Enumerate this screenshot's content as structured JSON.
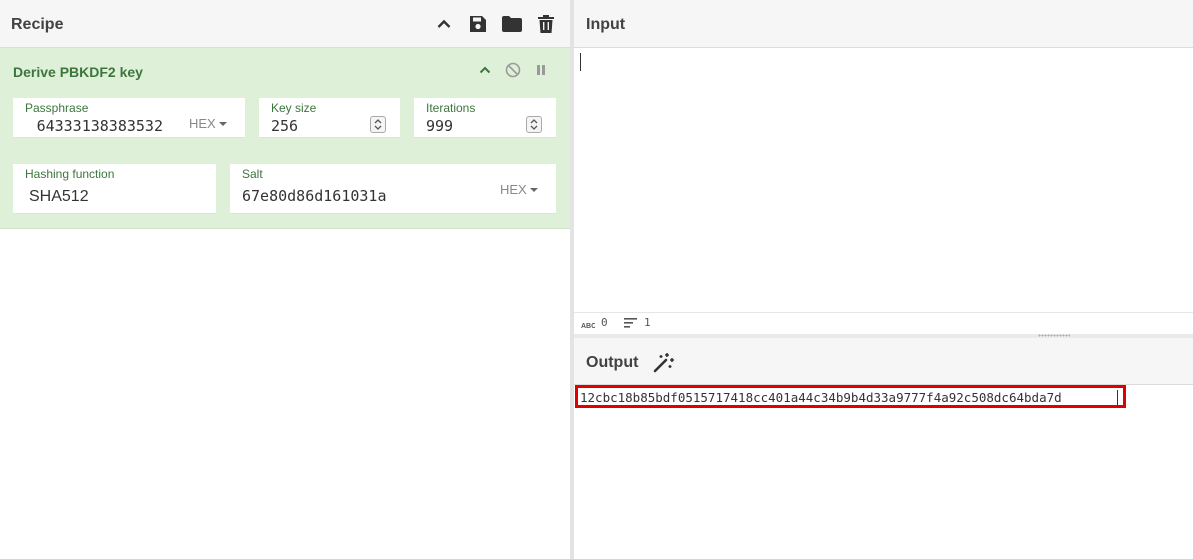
{
  "recipe": {
    "title": "Recipe",
    "header_icons": [
      "chevron-up-icon",
      "save-icon",
      "folder-icon",
      "trash-icon"
    ],
    "operation": {
      "title": "Derive PBKDF2 key",
      "icons": [
        "chevron-up-icon",
        "disable-icon",
        "pause-icon"
      ],
      "passphrase": {
        "label": "Passphrase",
        "value": "64333138383532",
        "format": "HEX"
      },
      "key_size": {
        "label": "Key size",
        "value": "256"
      },
      "iterations": {
        "label": "Iterations",
        "value": "999"
      },
      "hashing_function": {
        "label": "Hashing function",
        "value": "SHA512"
      },
      "salt": {
        "label": "Salt",
        "value": "67e80d86d161031a",
        "format": "HEX"
      }
    }
  },
  "input": {
    "title": "Input",
    "value": "",
    "status": {
      "length": "0",
      "lines": "1"
    }
  },
  "output": {
    "title": "Output",
    "value": "12cbc18b85bdf0515717418cc401a44c34b9b4d33a9777f4a92c508dc64bda7d"
  },
  "colors": {
    "operation_bg": "#dff0d8",
    "operation_title": "#3c763d",
    "highlight": "#e00000"
  }
}
